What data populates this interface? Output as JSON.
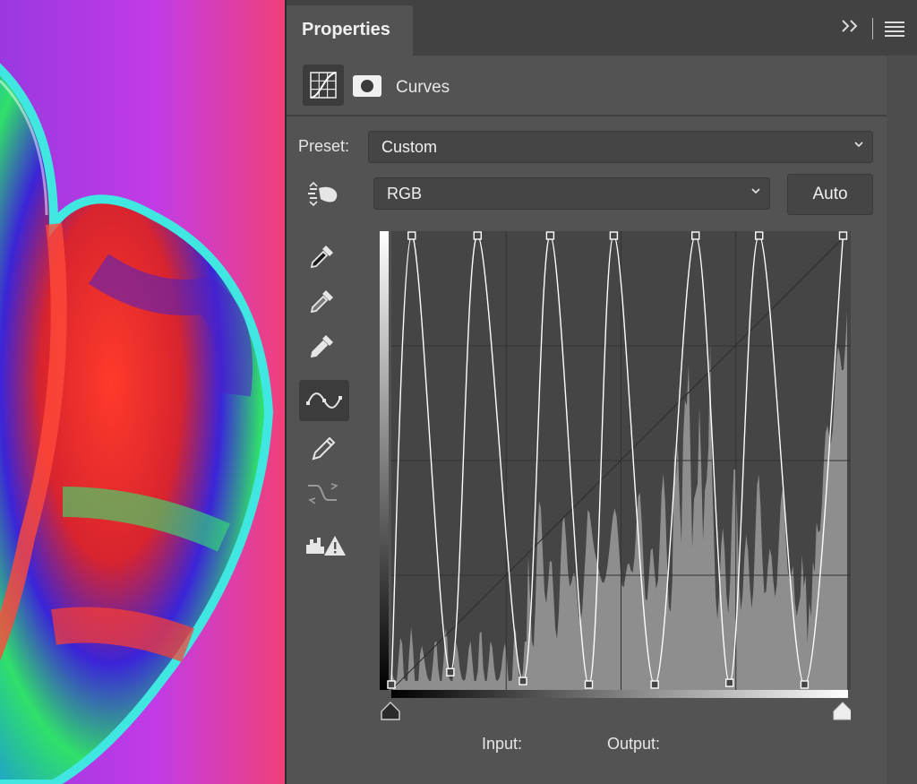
{
  "panel": {
    "tab_title": "Properties",
    "adjustment_label": "Curves",
    "preset_label": "Preset:",
    "preset_value": "Custom",
    "channel_value": "RGB",
    "auto_label": "Auto",
    "input_label": "Input:",
    "output_label": "Output:"
  },
  "icons": {
    "collapse": "double-chevron-right-icon",
    "menu": "hamburger-menu-icon",
    "adjustment": "curves-adjustment-icon",
    "mask": "layer-mask-icon",
    "tools": [
      "on-image-adjust-icon",
      "black-point-eyedropper-icon",
      "gray-point-eyedropper-icon",
      "white-point-eyedropper-icon",
      "curve-points-icon",
      "pencil-draw-icon",
      "smooth-curve-icon",
      "clipping-warning-icon"
    ]
  },
  "curve": {
    "points": [
      [
        0,
        1
      ],
      [
        4.5,
        255
      ],
      [
        13,
        8
      ],
      [
        19,
        255
      ],
      [
        29,
        3
      ],
      [
        35,
        255
      ],
      [
        43.5,
        1
      ],
      [
        49,
        255
      ],
      [
        58,
        1
      ],
      [
        67,
        255
      ],
      [
        74.5,
        2
      ],
      [
        81,
        255
      ],
      [
        91,
        1
      ],
      [
        99.5,
        255
      ]
    ]
  },
  "colors": {
    "panel_bg": "#535353",
    "tabbar_bg": "#424242",
    "graph_bg": "#454545",
    "histogram": "#8e8e8e",
    "curve": "#ffffff"
  }
}
